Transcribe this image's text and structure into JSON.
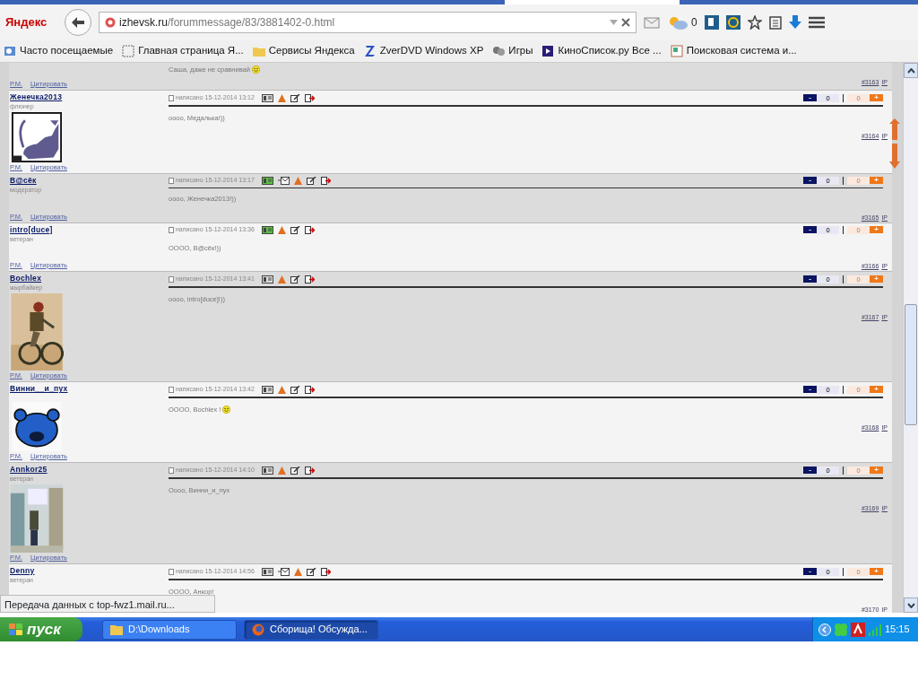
{
  "browser": {
    "logo": "Яндекс",
    "url_host": "izhevsk.ru",
    "url_path": "/forummessage/83/3881402-0.html",
    "weather": "0"
  },
  "bookmarks": [
    {
      "label": "Часто посещаемые",
      "kind": "search"
    },
    {
      "label": "Главная страница Я...",
      "kind": "blank"
    },
    {
      "label": "Сервисы Яндекса",
      "kind": "folder"
    },
    {
      "label": "ZverDVD Windows XP",
      "kind": "zed"
    },
    {
      "label": "Игры",
      "kind": "dice"
    },
    {
      "label": "КиноСписок.ру Все ...",
      "kind": "film"
    },
    {
      "label": "Поисковая система и...",
      "kind": "page"
    }
  ],
  "posts": [
    {
      "kind": "partial",
      "message": "Саша, даже не сравнивай",
      "smiley": true,
      "pm": "Р.М.",
      "quote": "Цитировать",
      "number": "#3163",
      "ip": "IP"
    },
    {
      "kind": "full",
      "author": "Женечка2013",
      "rank": "флюнер",
      "avatar": true,
      "posted": "написано 15-12-2014 13:12",
      "online": false,
      "mail": false,
      "down_label": "-",
      "down_count": "0",
      "up_count": "0",
      "up_label": "+",
      "message": "оооо, Медалька!))",
      "smiley": false,
      "pm": "Р.М.",
      "quote": "Цитировать",
      "number": "#3164",
      "ip": "IP"
    },
    {
      "kind": "full",
      "author": "B@сёк",
      "rank": "модератор",
      "avatar": false,
      "posted": "написано 15-12-2014 13:17",
      "online": true,
      "mail": true,
      "down_label": "-",
      "down_count": "0",
      "up_count": "0",
      "up_label": "+",
      "message": "оооо, Женечка2013!))",
      "smiley": false,
      "pm": "Р.М.",
      "quote": "Цитировать",
      "number": "#3165",
      "ip": "IP"
    },
    {
      "kind": "full",
      "author": "intro[duce]",
      "rank": "ветеран",
      "avatar": false,
      "posted": "написано 15-12-2014 13:36",
      "online": true,
      "mail": false,
      "down_label": "-",
      "down_count": "0",
      "up_count": "0",
      "up_label": "+",
      "message": "OOOO, B@сёк!))",
      "smiley": false,
      "pm": "Р.М.",
      "quote": "Цитировать",
      "number": "#3166",
      "ip": "IP"
    },
    {
      "kind": "full",
      "author": "Bochlex",
      "rank": "жырбайкер",
      "avatar": true,
      "posted": "написано 15-12-2014 13:41",
      "online": false,
      "mail": false,
      "down_label": "-",
      "down_count": "0",
      "up_count": "0",
      "up_label": "+",
      "message": "оооо, intro[duce]!))",
      "smiley": false,
      "pm": "Р.М.",
      "quote": "Цитировать",
      "number": "#3167",
      "ip": "IP"
    },
    {
      "kind": "full",
      "author": "Винни__и_пух",
      "avatar": true,
      "posted": "написано 15-12-2014 13:42",
      "online": false,
      "mail": false,
      "down_label": "-",
      "down_count": "0",
      "up_count": "0",
      "up_label": "+",
      "message": "OOOO, Bochlex !",
      "smiley": true,
      "pm": "Р.М.",
      "quote": "Цитировать",
      "number": "#3168",
      "ip": "IP"
    },
    {
      "kind": "full",
      "author": "Annkor25",
      "rank": "ветеран",
      "avatar": true,
      "posted": "написано 15-12-2014 14:10",
      "online": false,
      "mail": false,
      "down_label": "-",
      "down_count": "0",
      "up_count": "0",
      "up_label": "+",
      "message": "Oooo, Винни_и_пух",
      "smiley": false,
      "pm": "Р.М.",
      "quote": "Цитировать",
      "number": "#3169",
      "ip": "IP"
    },
    {
      "kind": "full",
      "author": "Denny",
      "rank": "ветеран",
      "avatar": false,
      "posted": "написано 15-12-2014 14:56",
      "online": false,
      "mail": true,
      "down_label": "-",
      "down_count": "0",
      "up_count": "0",
      "up_label": "+",
      "message": "OOOO, Анкор!",
      "smiley": false,
      "number": "#3170",
      "ip": "IP"
    }
  ],
  "status_bar": "Передача данных с top-fwz1.mail.ru...",
  "taskbar": {
    "start": "пуск",
    "tasks": [
      {
        "label": "D:\\Downloads",
        "kind": "folder",
        "selected": false
      },
      {
        "label": "Сборища! Обсужда...",
        "kind": "browser",
        "selected": true
      }
    ],
    "clock": "15:15"
  }
}
